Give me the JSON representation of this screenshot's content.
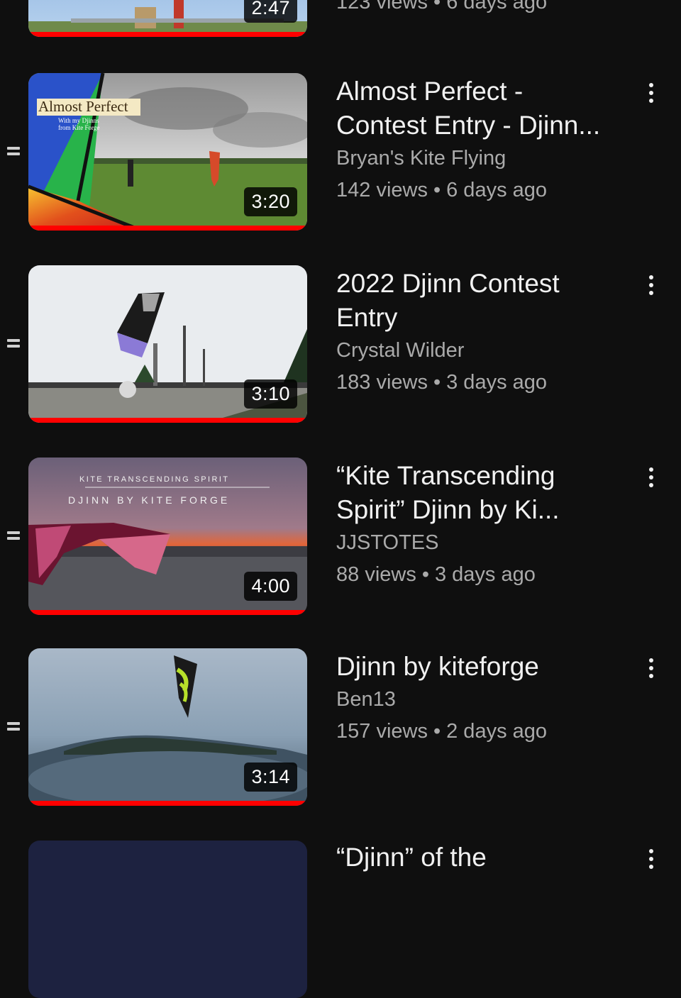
{
  "partial_top": {
    "duration": "2:47",
    "stats": "123 views • 6 days ago"
  },
  "videos": [
    {
      "title_line1": "Almost Perfect -",
      "title_line2": "Contest Entry - Djinn...",
      "channel": "Bryan's Kite Flying",
      "views": "142 views",
      "age": "6 days ago",
      "duration": "3:20",
      "thumb_text": {
        "headline": "Almost Perfect",
        "sub1": "With my Djinns",
        "sub2": "from Kite Forge"
      }
    },
    {
      "title_line1": "2022 Djinn Contest",
      "title_line2": "Entry",
      "channel": "Crystal Wilder",
      "views": "183 views",
      "age": "3 days ago",
      "duration": "3:10"
    },
    {
      "title_line1": "“Kite Transcending",
      "title_line2": "Spirit” Djinn by Ki...",
      "channel": "JJSTOTES",
      "views": "88 views",
      "age": "3 days ago",
      "duration": "4:00",
      "thumb_text": {
        "line1": "KITE TRANSCENDING SPIRIT",
        "line2": "DJINN BY KITE FORGE"
      }
    },
    {
      "title_line1": "Djinn by kiteforge",
      "title_line2": "",
      "channel": "Ben13",
      "views": "157 views",
      "age": "2 days ago",
      "duration": "3:14"
    }
  ],
  "partial_bottom": {
    "title_fragment": "“Djinn” of the"
  },
  "colors": {
    "background": "#0f0f0f",
    "progress": "#ff0000",
    "secondary_text": "#aaaaaa",
    "primary_text": "#f1f1f1"
  },
  "icons": [
    "drag-handle-icon",
    "more-vert-icon"
  ]
}
